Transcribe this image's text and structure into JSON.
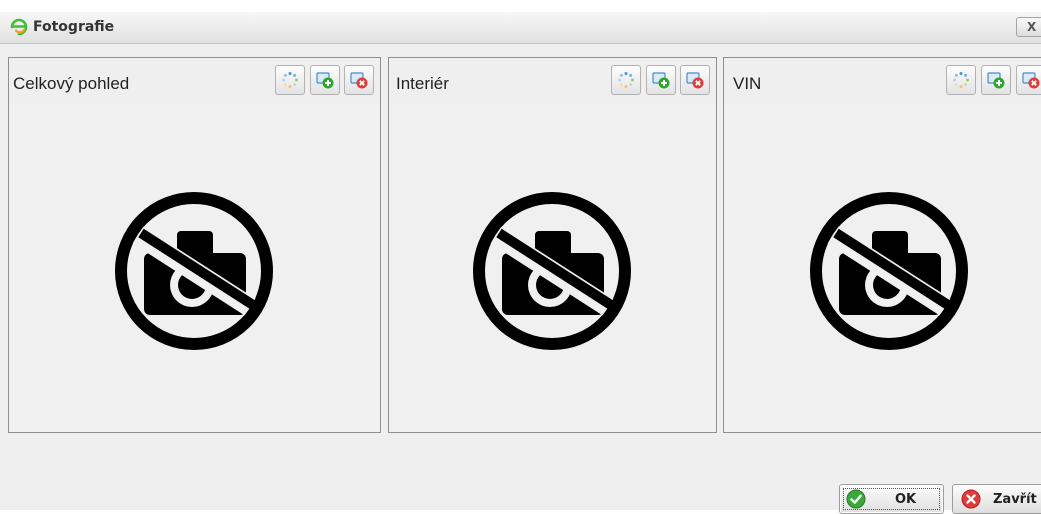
{
  "window": {
    "title": "Fotografie",
    "close_label": "X"
  },
  "panels": [
    {
      "title": "Celkový pohled"
    },
    {
      "title": "Interiér"
    },
    {
      "title": "VIN"
    }
  ],
  "toolbar_icons": [
    "loading-spinner-icon",
    "add-photo-icon",
    "remove-photo-icon"
  ],
  "placeholder_icon": "no-photo-icon",
  "buttons": {
    "ok": "OK",
    "close": "Zavřít"
  },
  "colors": {
    "add_green": "#2ea52e",
    "remove_red": "#e03a3a",
    "ok_green": "#3aa83a"
  }
}
